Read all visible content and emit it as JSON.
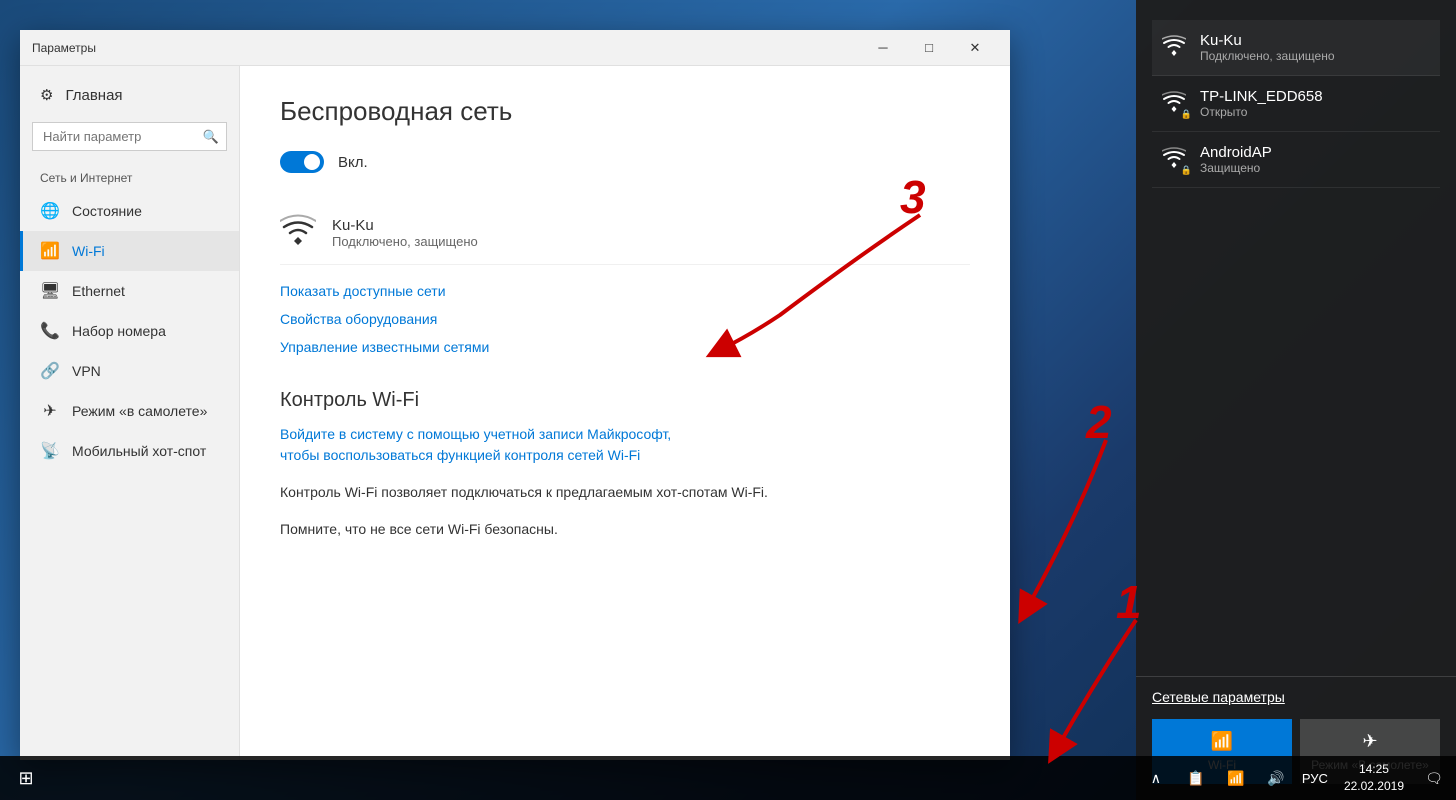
{
  "window": {
    "title": "Параметры",
    "controls": {
      "minimize": "─",
      "maximize": "□",
      "close": "✕"
    }
  },
  "sidebar": {
    "home_label": "Главная",
    "search_placeholder": "Найти параметр",
    "section_label": "Сеть и Интернет",
    "items": [
      {
        "id": "status",
        "label": "Состояние",
        "icon": "🌐"
      },
      {
        "id": "wifi",
        "label": "Wi-Fi",
        "icon": "📶",
        "active": true
      },
      {
        "id": "ethernet",
        "label": "Ethernet",
        "icon": "🖥"
      },
      {
        "id": "dialup",
        "label": "Набор номера",
        "icon": "📞"
      },
      {
        "id": "vpn",
        "label": "VPN",
        "icon": "🔗"
      },
      {
        "id": "airplane",
        "label": "Режим «в самолете»",
        "icon": "✈"
      },
      {
        "id": "hotspot",
        "label": "Мобильный хот-спот",
        "icon": "📡"
      }
    ]
  },
  "main": {
    "title": "Беспроводная сеть",
    "toggle_label": "Вкл.",
    "network_name": "Ku-Ku",
    "network_status": "Подключено, защищено",
    "show_networks_link": "Показать доступные сети",
    "adapter_props_link": "Свойства оборудования",
    "manage_networks_link": "Управление известными сетями",
    "section_wifi_control": "Контроль Wi-Fi",
    "wifi_control_link": "Войдите в систему с помощью учетной записи Майкрософт,\nчтобы воспользоваться функцией контроля сетей Wi-Fi",
    "body_text_1": "Контроль Wi-Fi позволяет подключаться к предлагаемым хот-спотам Wi-Fi.",
    "body_text_2": "Помните, что не все сети Wi-Fi безопасны."
  },
  "flyout": {
    "networks": [
      {
        "name": "Ku-Ku",
        "status": "Подключено, защищено",
        "secured": true,
        "connected": true
      },
      {
        "name": "TP-LINK_EDD658",
        "status": "Открыто",
        "secured": false,
        "connected": false
      },
      {
        "name": "AndroidAP",
        "status": "Защищено",
        "secured": true,
        "connected": false
      }
    ],
    "network_settings_label": "Сетевые параметры",
    "tiles": [
      {
        "id": "wifi",
        "label": "Wi-Fi",
        "icon": "📶"
      },
      {
        "id": "airplane",
        "label": "Режим «В самолете»",
        "icon": "✈"
      }
    ]
  },
  "taskbar": {
    "start_icon": "⊞",
    "tray_icons": [
      "∧",
      "📋",
      "📶",
      "🔊",
      "РУС"
    ],
    "time": "14:25",
    "date": "22.02.2019",
    "notification_icon": "🗨",
    "lang": "РУС"
  },
  "arrows": {
    "num1": "1",
    "num2": "2",
    "num3": "3"
  }
}
